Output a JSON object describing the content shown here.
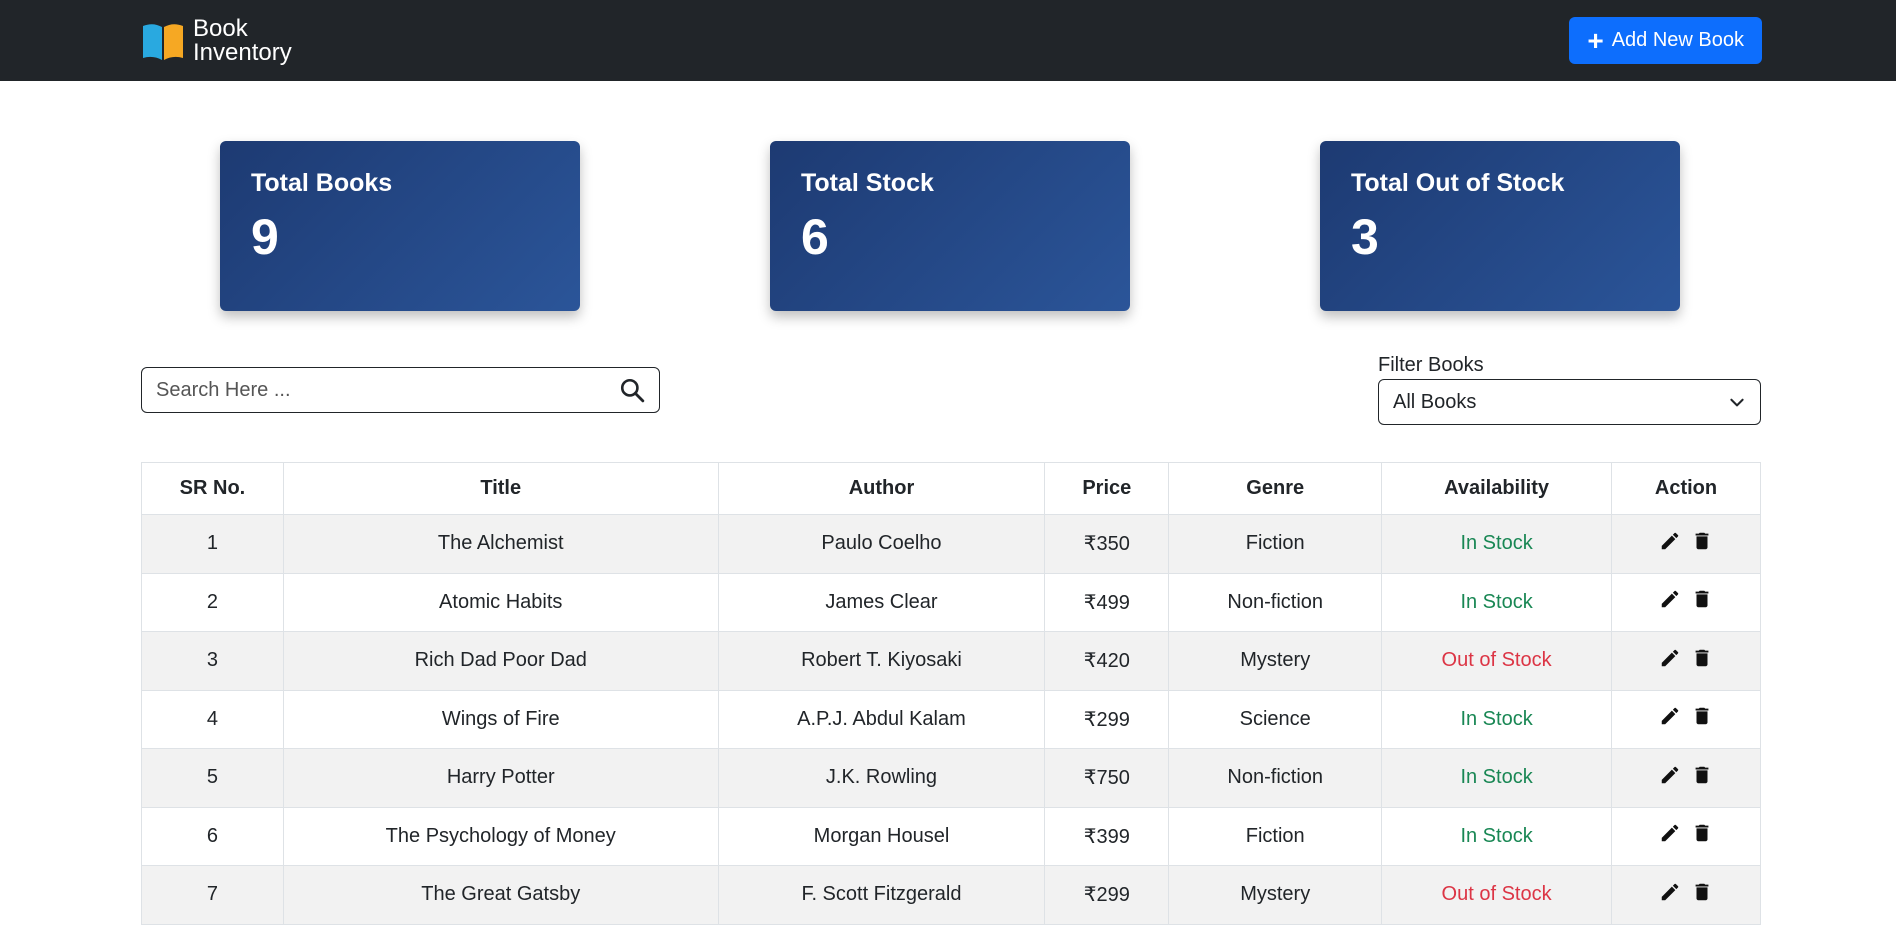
{
  "brand": {
    "line1": "Book",
    "line2": "Inventory",
    "logo_icon": "open-book-icon"
  },
  "navbar": {
    "add_button_label": "Add New Book",
    "add_button_icon": "plus-icon",
    "bg_color": "#212529",
    "accent": "#0d6efd"
  },
  "stats": [
    {
      "label": "Total Books",
      "value": "9"
    },
    {
      "label": "Total Stock",
      "value": "6"
    },
    {
      "label": "Total Out of Stock",
      "value": "3"
    }
  ],
  "search": {
    "placeholder": "Search Here ...",
    "value": "",
    "icon": "search-icon"
  },
  "filter": {
    "label": "Filter Books",
    "selected": "All Books",
    "icon": "chevron-down-icon"
  },
  "table": {
    "columns": [
      "SR No.",
      "Title",
      "Author",
      "Price",
      "Genre",
      "Availability",
      "Action"
    ],
    "rows": [
      {
        "sr": "1",
        "title": "The Alchemist",
        "author": "Paulo Coelho",
        "price": "₹350",
        "genre": "Fiction",
        "availability": "In Stock"
      },
      {
        "sr": "2",
        "title": "Atomic Habits",
        "author": "James Clear",
        "price": "₹499",
        "genre": "Non-fiction",
        "availability": "In Stock"
      },
      {
        "sr": "3",
        "title": "Rich Dad Poor Dad",
        "author": "Robert T. Kiyosaki",
        "price": "₹420",
        "genre": "Mystery",
        "availability": "Out of Stock"
      },
      {
        "sr": "4",
        "title": "Wings of Fire",
        "author": "A.P.J. Abdul Kalam",
        "price": "₹299",
        "genre": "Science",
        "availability": "In Stock"
      },
      {
        "sr": "5",
        "title": "Harry Potter",
        "author": "J.K. Rowling",
        "price": "₹750",
        "genre": "Non-fiction",
        "availability": "In Stock"
      },
      {
        "sr": "6",
        "title": "The Psychology of Money",
        "author": "Morgan Housel",
        "price": "₹399",
        "genre": "Fiction",
        "availability": "In Stock"
      },
      {
        "sr": "7",
        "title": "The Great Gatsby",
        "author": "F. Scott Fitzgerald",
        "price": "₹299",
        "genre": "Mystery",
        "availability": "Out of Stock"
      }
    ],
    "status_colors": {
      "in": "#198754",
      "out": "#dc3545"
    },
    "action_icons": [
      "edit-pencil-icon",
      "delete-trash-icon"
    ]
  }
}
